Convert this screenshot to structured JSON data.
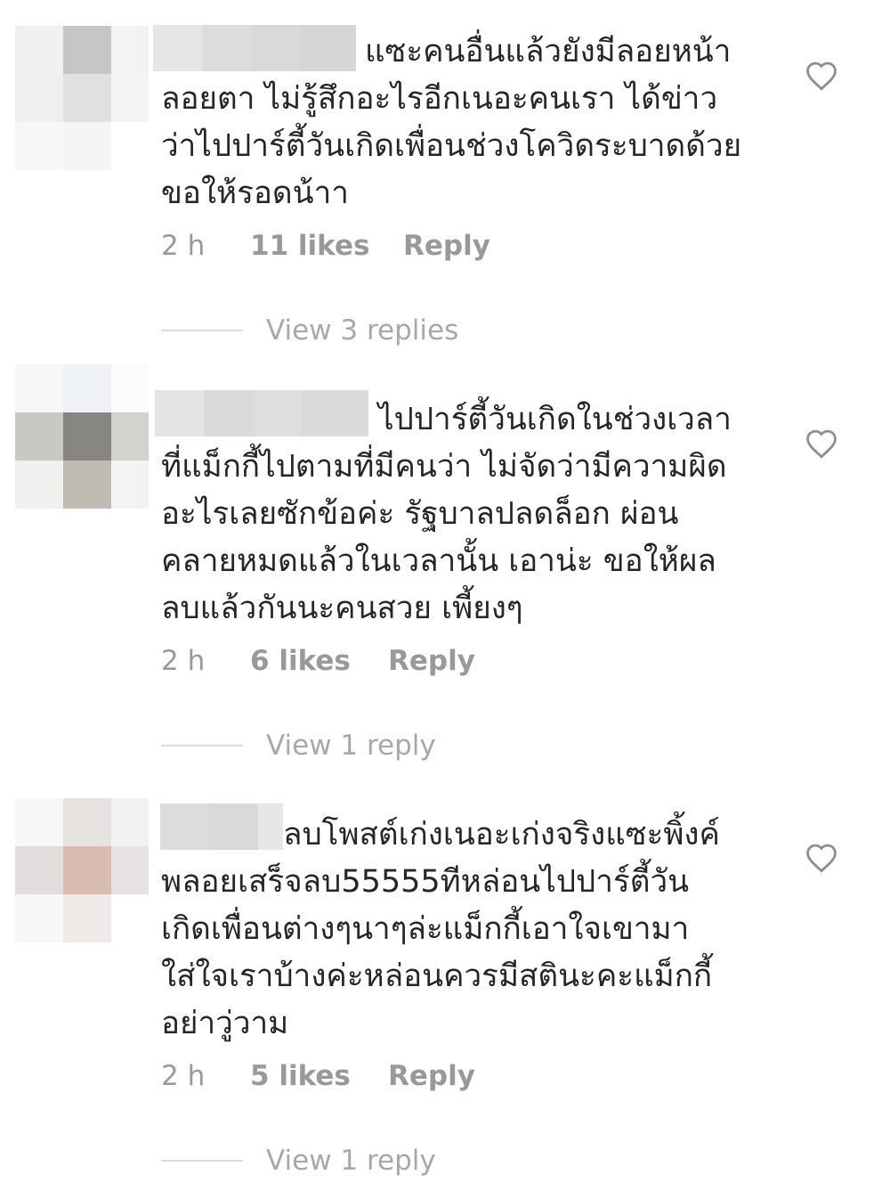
{
  "comments": [
    {
      "text": "แซะคนอื่นแล้วยังมีลอยหน้า\nลอยตา ไม่รู้สึกอะไรอีกเนอะคนเรา ได้ข่าว\nว่าไปปาร์ตี้วันเกิดเพื่อนช่วงโควิดระบาดด้วย\nขอให้รอดน้าา",
      "time": "2 h",
      "likes": "11 likes",
      "reply_label": "Reply",
      "view_replies": "View 3 replies"
    },
    {
      "text": "ไปปาร์ตี้วันเกิดในช่วงเวลา\nที่แม็กกี้ไปตามที่มีคนว่า  ไม่จัดว่ามีความผิด\nอะไรเลยซักข้อค่ะ รัฐบาลปลดล็อก ผ่อน\nคลายหมดแล้วในเวลานั้น  เอาน่ะ ขอให้ผล\nลบแล้วกันนะคนสวย เพี้ยงๆ",
      "time": "2 h",
      "likes": "6 likes",
      "reply_label": "Reply",
      "view_replies": "View 1 reply"
    },
    {
      "text": "ลบโพสต์เก่งเนอะเก่งจริงแซะพิ้งค์\nพลอยเสร็จลบ55555ทีหล่อนไปปาร์ตี้วัน\nเกิดเพื่อนต่างๆนาๆล่ะแม็กกี้เอาใจเขามา\nใส่ใจเราบ้างค่ะหล่อนควรมีสตินะคะแม็กกี้\nอย่าวู่วาม",
      "time": "2 h",
      "likes": "5 likes",
      "reply_label": "Reply",
      "view_replies": "View 1 reply"
    }
  ],
  "icons": {
    "like": "heart-outline-icon"
  },
  "colors": {
    "text": "#262626",
    "meta": "#999999",
    "view_replies": "#a8a8a8",
    "divider": "#dbdbdb"
  }
}
